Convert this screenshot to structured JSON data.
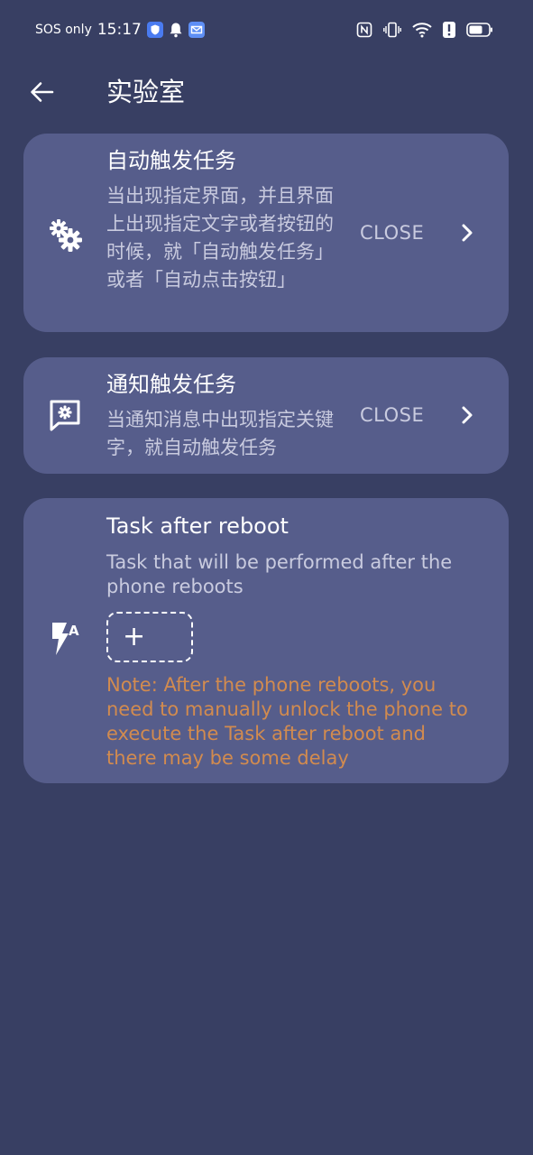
{
  "status_bar": {
    "carrier": "SOS only",
    "time": "15:17"
  },
  "header": {
    "title": "实验室"
  },
  "cards": [
    {
      "title": "自动触发任务",
      "description": "当出现指定界面，并且界面上出现指定文字或者按钮的时候，就「自动触发任务」或者「自动点击按钮」",
      "status": "CLOSE",
      "icon": "gears-icon"
    },
    {
      "title": "通知触发任务",
      "description": "当通知消息中出现指定关键字，就自动触发任务",
      "status": "CLOSE",
      "icon": "notification-settings-icon"
    },
    {
      "title": "Task after reboot",
      "description": "Task that will be performed after the phone reboots",
      "add_label": "+",
      "note": "Note: After the phone reboots, you need to manually unlock the phone to execute the Task after reboot and there may be some delay",
      "icon": "flash-auto-icon"
    }
  ],
  "colors": {
    "background": "#383f63",
    "card": "#565d8b",
    "note": "#d28b4f"
  }
}
